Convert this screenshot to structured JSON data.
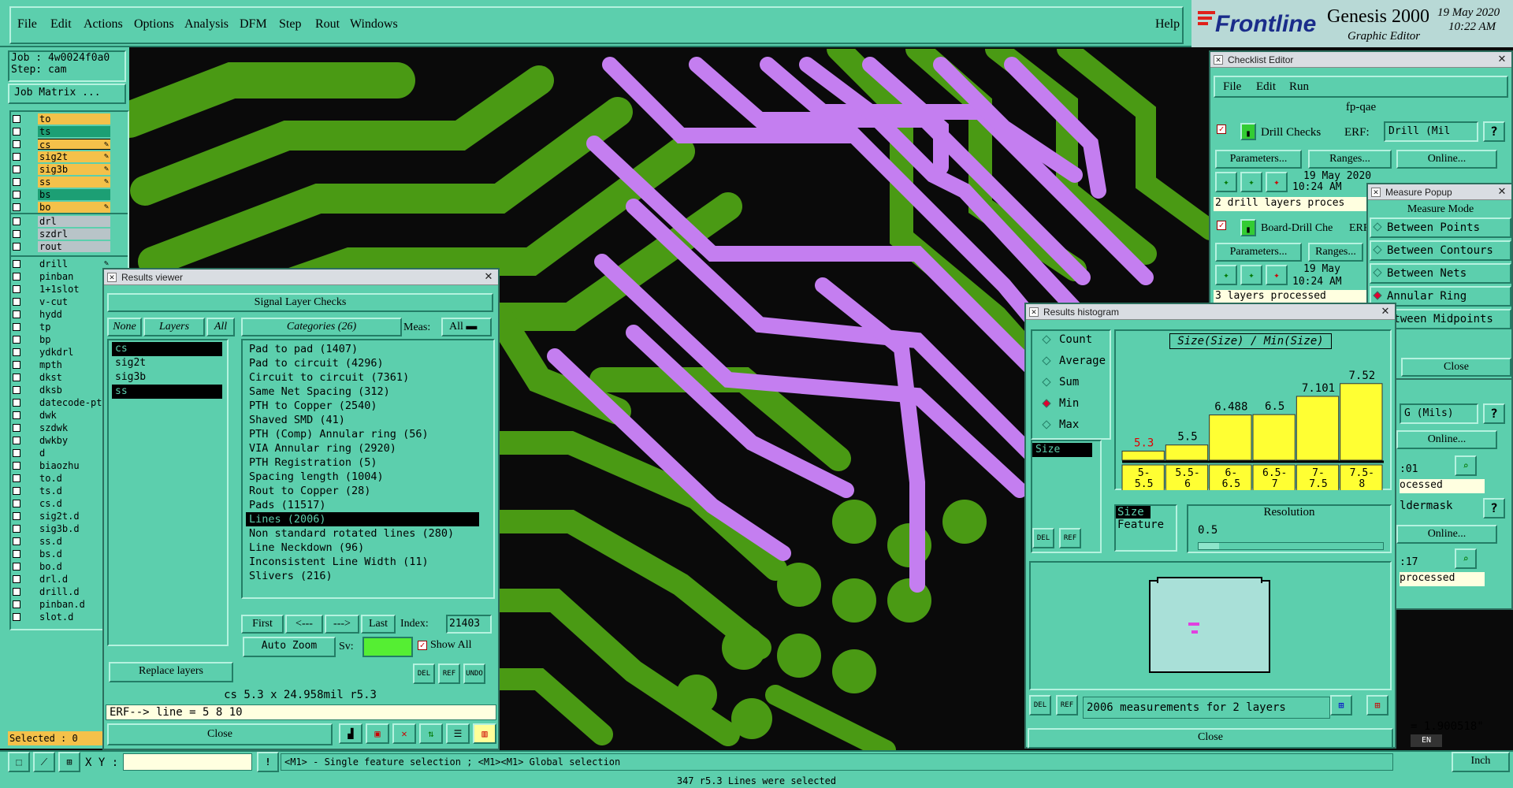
{
  "menubar": {
    "items": [
      "File",
      "Edit",
      "Actions",
      "Options",
      "Analysis",
      "DFM",
      "Step",
      "Rout",
      "Windows"
    ],
    "help": "Help"
  },
  "brand": {
    "logo": "Frontline",
    "product": "Genesis 2000",
    "subtitle": "Graphic Editor",
    "date": "19 May 2020",
    "time": "10:22 AM"
  },
  "job": {
    "job_label": "Job : 4w0024f0a0",
    "step_label": "Step: cam",
    "matrix_button": "Job Matrix ..."
  },
  "layers": {
    "group1": [
      "to",
      "ts",
      "cs",
      "sig2t",
      "sig3b",
      "ss",
      "bs",
      "bo"
    ],
    "group2": [
      "drl",
      "szdrl",
      "rout"
    ],
    "group3": [
      "drill",
      "pinban",
      "1+1slot",
      "v-cut",
      "hydd",
      "tp",
      "bp",
      "ydkdrl",
      "mpth",
      "dkst",
      "dksb",
      "datecode-pt",
      "dwk",
      "szdwk",
      "dwkby",
      "d",
      "biaozhu",
      "to.d",
      "ts.d",
      "cs.d",
      "sig2t.d",
      "sig3b.d",
      "ss.d",
      "bs.d",
      "bo.d",
      "drl.d",
      "drill.d",
      "pinban.d",
      "slot.d"
    ],
    "selected_label": "Selected : 0"
  },
  "results_viewer": {
    "title": "Results viewer",
    "header": "Signal Layer Checks",
    "none_btn": "None",
    "layers_btn": "Layers",
    "all_btn": "All",
    "categories_btn": "Categories (26)",
    "meas_label": "Meas:",
    "meas_value": "All",
    "layers": [
      "cs",
      "sig2t",
      "sig3b",
      "ss"
    ],
    "categories": [
      "Pad to pad (1407)",
      "Pad to circuit (4296)",
      "Circuit to circuit (7361)",
      "Same Net Spacing (312)",
      "PTH to Copper (2540)",
      "Shaved SMD (41)",
      "PTH (Comp) Annular ring (56)",
      "VIA Annular ring (2920)",
      "PTH Registration (5)",
      "Spacing length (1004)",
      "Rout to Copper (28)",
      "Pads (11517)",
      "Lines (2006)",
      "Non standard rotated lines (280)",
      "Line Neckdown (96)",
      "Inconsistent Line Width (11)",
      "Slivers (216)"
    ],
    "selected_category": "Lines (2006)",
    "first": "First",
    "prev": "<---",
    "next": "--->",
    "last": "Last",
    "index_label": "Index:",
    "index_value": "21403",
    "autozoom": "Auto Zoom",
    "sv_label": "Sv:",
    "show_all": "Show All",
    "replace_layers": "Replace layers",
    "status_line": "cs 5.3 x 24.958mil  r5.3",
    "erf_line": "ERF--> line = 5 8 10",
    "close": "Close",
    "del": "DEL",
    "ref": "REF",
    "undo": "UNDO"
  },
  "checklist": {
    "title": "Checklist Editor",
    "menu": [
      "File",
      "Edit",
      "Run"
    ],
    "name": "fp-qae",
    "drill_checks": "Drill Checks",
    "erf_label": "ERF:",
    "erf_value": "Drill (Mil",
    "params": "Parameters...",
    "ranges": "Ranges...",
    "online": "Online...",
    "date1": "19 May 2020",
    "time1": "10:24 AM",
    "status1": "2 drill layers proces",
    "board_drill": "Board-Drill Che",
    "erf2": "ERF",
    "date2": "19 May",
    "time2": "10:24 AM",
    "status2": "3 layers processed",
    "erf3": "G (Mils)",
    "time3": ":01",
    "status3": "ocessed",
    "soldermask": "ldermask",
    "time4": ":17",
    "status4": "processed",
    "online2": "Online...",
    "online3": "Online..."
  },
  "measure": {
    "title": "Measure Popup",
    "mode": "Measure Mode",
    "items": [
      "Between Points",
      "Between Contours",
      "Between Nets",
      "Annular Ring",
      "etween Midpoints"
    ],
    "close": "Close",
    "value": "= 1.900518\"",
    "unit": "Inch"
  },
  "histogram": {
    "title": "Results histogram",
    "options": [
      "Count",
      "Average",
      "Sum",
      "Min",
      "Max"
    ],
    "selected": "Min",
    "list_item": "Size",
    "chart_title": "Size(Size) / Min(Size)",
    "size_label": "Size",
    "feature_label": "Feature",
    "resolution_label": "Resolution",
    "resolution_value": "0.5",
    "summary": "2006 measurements for 2 layers",
    "close": "Close",
    "del": "DEL",
    "ref": "REF"
  },
  "chart_data": {
    "type": "bar",
    "title": "Size(Size) / Min(Size)",
    "categories": [
      "5-\n5.5",
      "5.5-\n6",
      "6-\n6.5",
      "6.5-\n7",
      "7-\n7.5",
      "7.5-\n8"
    ],
    "values": [
      5.3,
      5.5,
      6.488,
      6.5,
      7.101,
      7.52
    ],
    "value_labels": [
      "5.3",
      "5.5",
      "6.488",
      "6.5",
      "7.101",
      "7.52"
    ],
    "ylim": [
      5,
      7.8
    ],
    "highlight_color": "#e00000",
    "bar_color": "#ffff33"
  },
  "statusbar": {
    "xy_label": "X Y :",
    "hint": "<M1> - Single feature selection ; <M1><M1> Global selection",
    "bottom": "347 r5.3 Lines were selected",
    "lang": "EN"
  },
  "colors": {
    "copper": "#4a9a14",
    "trace": "#c47ef0",
    "bg": "#0a0a0a",
    "panel": "#5ccfad"
  }
}
